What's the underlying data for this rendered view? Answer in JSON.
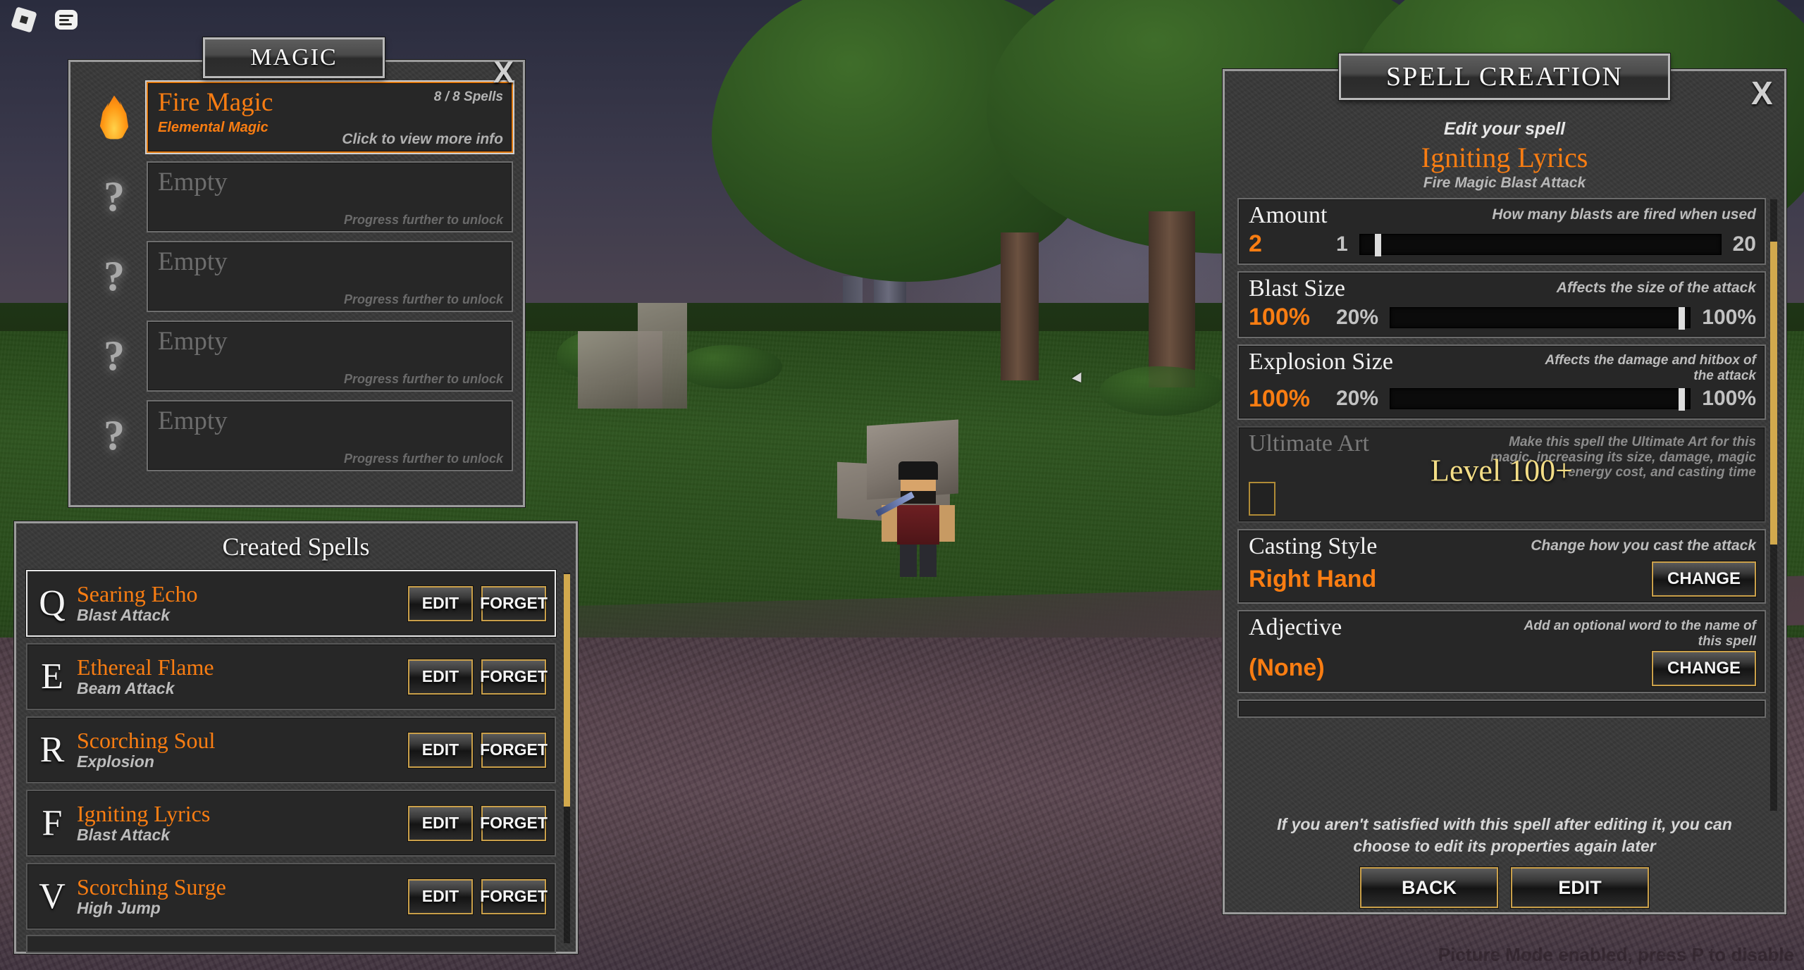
{
  "topbar": {
    "roblox_icon": "roblox-logo-icon",
    "chat_icon": "chat-menu-icon"
  },
  "magic_panel": {
    "title": "MAGIC",
    "close_label": "X",
    "slots": [
      {
        "icon": "fire-flame-icon",
        "name": "Fire Magic",
        "subtitle": "Elemental Magic",
        "count": "8 / 8 Spells",
        "hint": "Click to view more info",
        "state": "active"
      },
      {
        "icon": "question-mark-icon",
        "name": "Empty",
        "subtitle": "",
        "count": "",
        "hint": "Progress further to unlock",
        "state": "locked"
      },
      {
        "icon": "question-mark-icon",
        "name": "Empty",
        "subtitle": "",
        "count": "",
        "hint": "Progress further to unlock",
        "state": "locked"
      },
      {
        "icon": "question-mark-icon",
        "name": "Empty",
        "subtitle": "",
        "count": "",
        "hint": "Progress further to unlock",
        "state": "locked"
      },
      {
        "icon": "question-mark-icon",
        "name": "Empty",
        "subtitle": "",
        "count": "",
        "hint": "Progress further to unlock",
        "state": "locked"
      }
    ]
  },
  "spells_panel": {
    "title": "Created Spells",
    "edit_label": "EDIT",
    "forget_label": "FORGET",
    "rows": [
      {
        "key": "Q",
        "name": "Searing Echo",
        "type": "Blast Attack",
        "selected": true
      },
      {
        "key": "E",
        "name": "Ethereal Flame",
        "type": "Beam Attack",
        "selected": false
      },
      {
        "key": "R",
        "name": "Scorching Soul",
        "type": "Explosion",
        "selected": false
      },
      {
        "key": "F",
        "name": "Igniting Lyrics",
        "type": "Blast Attack",
        "selected": false
      },
      {
        "key": "V",
        "name": "Scorching Surge",
        "type": "High Jump",
        "selected": false
      }
    ]
  },
  "creation_panel": {
    "title": "SPELL CREATION",
    "close_label": "X",
    "subtitle": "Edit your spell",
    "spell_name": "Igniting Lyrics",
    "spell_kind": "Fire Magic Blast Attack",
    "properties": [
      {
        "label": "Amount",
        "desc": "How many blasts are fired when used",
        "value": "2",
        "min_label": "1",
        "max_label": "20",
        "fill_percent": 5,
        "control": "slider"
      },
      {
        "label": "Blast Size",
        "desc": "Affects the size of the attack",
        "value": "100%",
        "min_label": "20%",
        "max_label": "100%",
        "fill_percent": 97,
        "control": "slider"
      },
      {
        "label": "Explosion Size",
        "desc": "Affects the damage and hitbox of the attack",
        "value": "100%",
        "min_label": "20%",
        "max_label": "100%",
        "fill_percent": 97,
        "control": "slider"
      },
      {
        "label": "Ultimate Art",
        "desc": "Make this spell the Ultimate Art for this magic, increasing its size, damage, magic energy cost, and casting time",
        "value": "",
        "control": "checkbox",
        "checked": false,
        "locked": true,
        "lock_text": "Level 100+"
      },
      {
        "label": "Casting Style",
        "desc": "Change how you cast the attack",
        "value": "Right Hand",
        "control": "button",
        "button_label": "CHANGE"
      },
      {
        "label": "Adjective",
        "desc": "Add an optional word to the name of this spell",
        "value": "(None)",
        "control": "button",
        "button_label": "CHANGE"
      }
    ],
    "footer_note": "If you aren't satisfied with this spell after editing it, you can choose to edit its properties again later",
    "back_label": "BACK",
    "edit_label": "EDIT"
  },
  "status": {
    "picture_mode": "Picture Mode enabled, press P to disable"
  },
  "colors": {
    "accent_orange": "#f97d12",
    "gold_border": "#caa04a",
    "panel_bg": "#3a3a3a",
    "card_bg": "#272727",
    "lock_yellow": "#f3dd86"
  }
}
